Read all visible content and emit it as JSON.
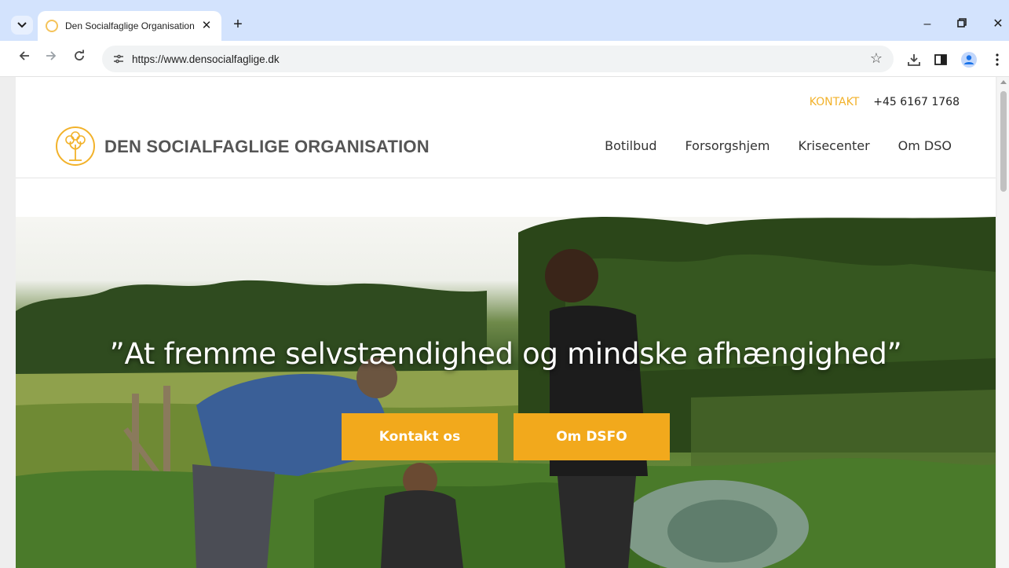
{
  "browser": {
    "tab": {
      "title": "Den Socialfaglige Organisation"
    },
    "address": {
      "url": "https://www.densocialfaglige.dk"
    }
  },
  "header": {
    "contact_label": "KONTAKT",
    "phone": "+45 6167 1768",
    "brand_name": "DEN SOCIALFAGLIGE ORGANISATION",
    "nav": [
      {
        "label": "Botilbud"
      },
      {
        "label": "Forsorgshjem"
      },
      {
        "label": "Krisecenter"
      },
      {
        "label": "Om DSO"
      }
    ]
  },
  "hero": {
    "quote": "”At fremme selvstændighed og mindske afhængighed”",
    "buttons": [
      {
        "label": "Kontakt os"
      },
      {
        "label": "Om DSFO"
      }
    ]
  },
  "colors": {
    "accent": "#f2a91c",
    "contact_link": "#f2b22b",
    "tabbar": "#d3e3fd"
  }
}
